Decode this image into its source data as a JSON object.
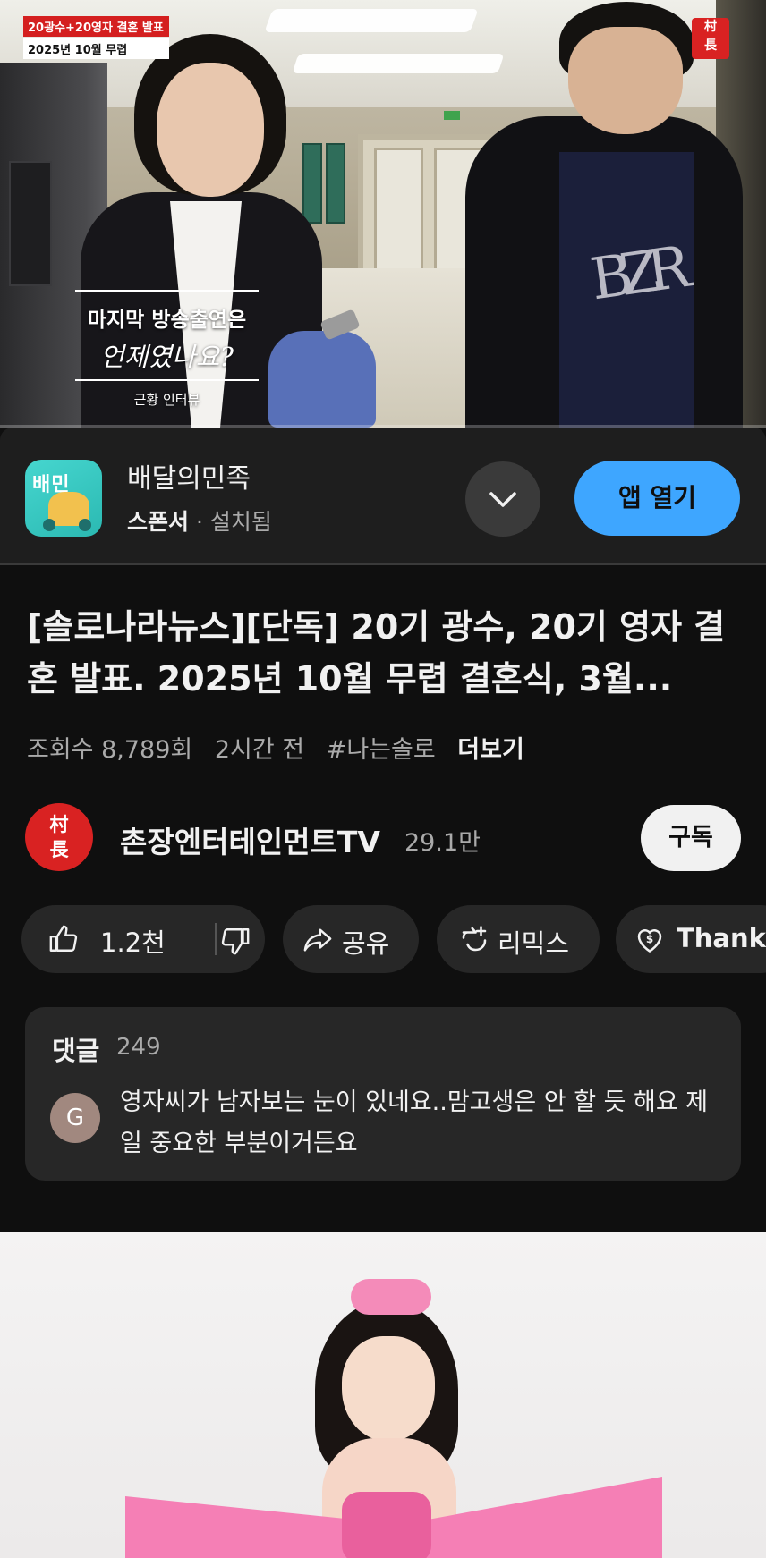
{
  "video": {
    "badge_top": "20광수+20영자 결혼 발표",
    "badge_bottom": "2025년 10월 무렵",
    "caption_line1": "마지막 방송출연은",
    "caption_line2": "언제였나요?",
    "caption_line3": "근황 인터뷰",
    "watch_progress": 0
  },
  "ad": {
    "app_name": "배달의민족",
    "app_icon_text": "배민",
    "sponsor_label": "스폰서",
    "separator": " · ",
    "install_status": "설치됨",
    "open_button": "앱 열기"
  },
  "title": "[솔로나라뉴스][단독] 20기 광수, 20기 영자 결혼 발표. 2025년 10월 무렵 결혼식, 3월...",
  "meta": {
    "views": "조회수 8,789회",
    "age": "2시간 전",
    "hashtag": "#나는솔로",
    "more": "더보기"
  },
  "channel": {
    "name": "촌장엔터테인먼트TV",
    "subscribers": "29.1만",
    "subscribe_button": "구독"
  },
  "actions": {
    "likes": "1.2천",
    "share": "공유",
    "remix": "리믹스",
    "thanks": "Thanks"
  },
  "comments": {
    "header": "댓글",
    "count": "249",
    "top_comment_avatar": "G",
    "top_comment_text": "영자씨가 남자보는 눈이 있네요..맘고생은 안 할 듯 해요 제일 중요한 부분이거든요"
  },
  "colors": {
    "background": "#0f0f0f",
    "chip": "#272727",
    "accent_blue": "#3ea6ff",
    "channel_red": "#d92222"
  },
  "icons": [
    "chevron-down-icon",
    "thumbs-up-icon",
    "thumbs-down-icon",
    "share-icon",
    "remix-icon",
    "thanks-icon"
  ]
}
